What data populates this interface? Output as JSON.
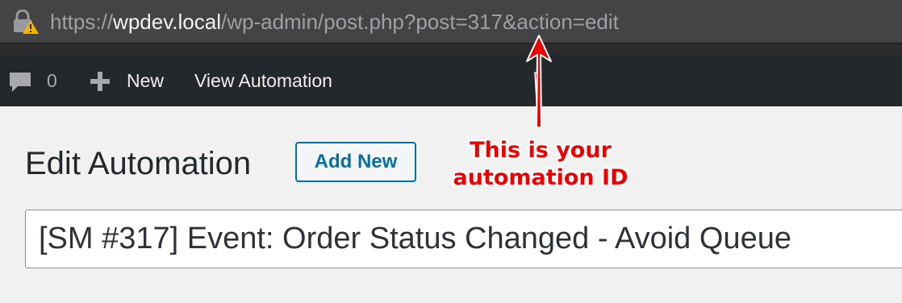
{
  "browser": {
    "url_prefix": "https://",
    "url_domain": "wpdev.local",
    "url_path": "/wp-admin/post.php?post=317&action=edit"
  },
  "admin_bar": {
    "comment_count": "0",
    "new_label": "New",
    "view_label": "View Automation"
  },
  "page": {
    "title": "Edit Automation",
    "add_new_label": "Add New",
    "post_title_value": "[SM #317] Event: Order Status Changed - Avoid Queue"
  },
  "annotation": {
    "line1": "This is your",
    "line2": "automation ID",
    "color": "#ee0000"
  },
  "icons": {
    "lock": "lock-warning-icon",
    "comment": "comment-icon",
    "plus": "plus-icon"
  }
}
